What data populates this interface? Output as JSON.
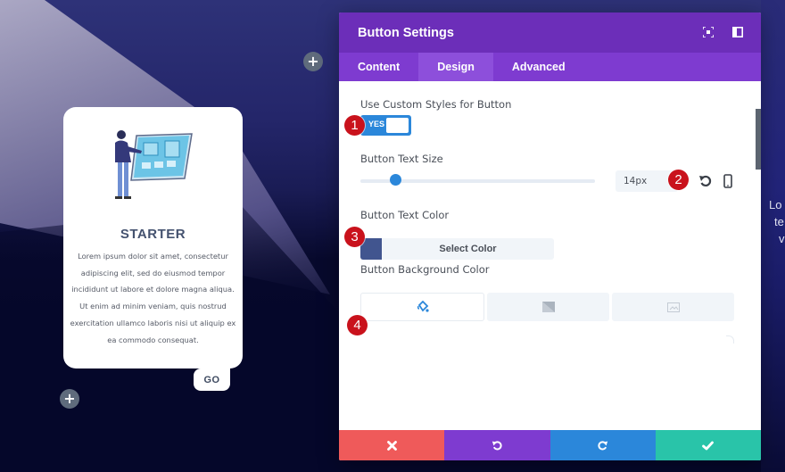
{
  "background": {
    "right_text_lines": [
      "Lo",
      "te",
      "v"
    ]
  },
  "card": {
    "title": "STARTER",
    "description": "Lorem ipsum dolor sit amet, consectetur adipiscing elit, sed do eiusmod tempor incididunt ut labore et dolore magna aliqua. Ut enim ad minim veniam, quis nostrud exercitation ullamco laboris nisi ut aliquip ex ea commodo consequat.",
    "button_label": "GO",
    "illustration": "person-at-touchscreen-illustration"
  },
  "add_buttons": [
    {
      "icon": "plus-icon",
      "symbol": "+"
    },
    {
      "icon": "plus-icon",
      "symbol": "+"
    }
  ],
  "modal": {
    "title": "Button Settings",
    "header_icons": [
      "expand-icon",
      "split-view-icon"
    ],
    "tabs": [
      {
        "label": "Content",
        "active": false
      },
      {
        "label": "Design",
        "active": true
      },
      {
        "label": "Advanced",
        "active": false
      }
    ],
    "fields": {
      "custom_styles": {
        "label": "Use Custom Styles for Button",
        "toggle_label": "YES",
        "value": true
      },
      "text_size": {
        "label": "Button Text Size",
        "value": "14px",
        "slider_fraction": 0.15
      },
      "text_color": {
        "label": "Button Text Color",
        "swatch_color": "#41558f",
        "select_label": "Select Color"
      },
      "background_color": {
        "label": "Button Background Color",
        "tabs": [
          {
            "icon": "paint-bucket-icon",
            "active": true
          },
          {
            "icon": "gradient-icon",
            "active": false
          },
          {
            "icon": "image-icon",
            "active": false
          }
        ]
      }
    },
    "footer": {
      "buttons": [
        {
          "name": "cancel",
          "icon": "close-icon",
          "color": "#ef5a5a"
        },
        {
          "name": "undo",
          "icon": "undo-icon",
          "color": "#7e3bd0"
        },
        {
          "name": "redo",
          "icon": "redo-icon",
          "color": "#2b87da"
        },
        {
          "name": "save",
          "icon": "check-icon",
          "color": "#29c4a9"
        }
      ]
    }
  },
  "annotations": [
    "1",
    "2",
    "3",
    "4"
  ],
  "colors": {
    "header_purple": "#6c2eb9",
    "tab_purple": "#7e3bd0",
    "accent_blue": "#2b87da",
    "badge_red": "#c9121c"
  }
}
